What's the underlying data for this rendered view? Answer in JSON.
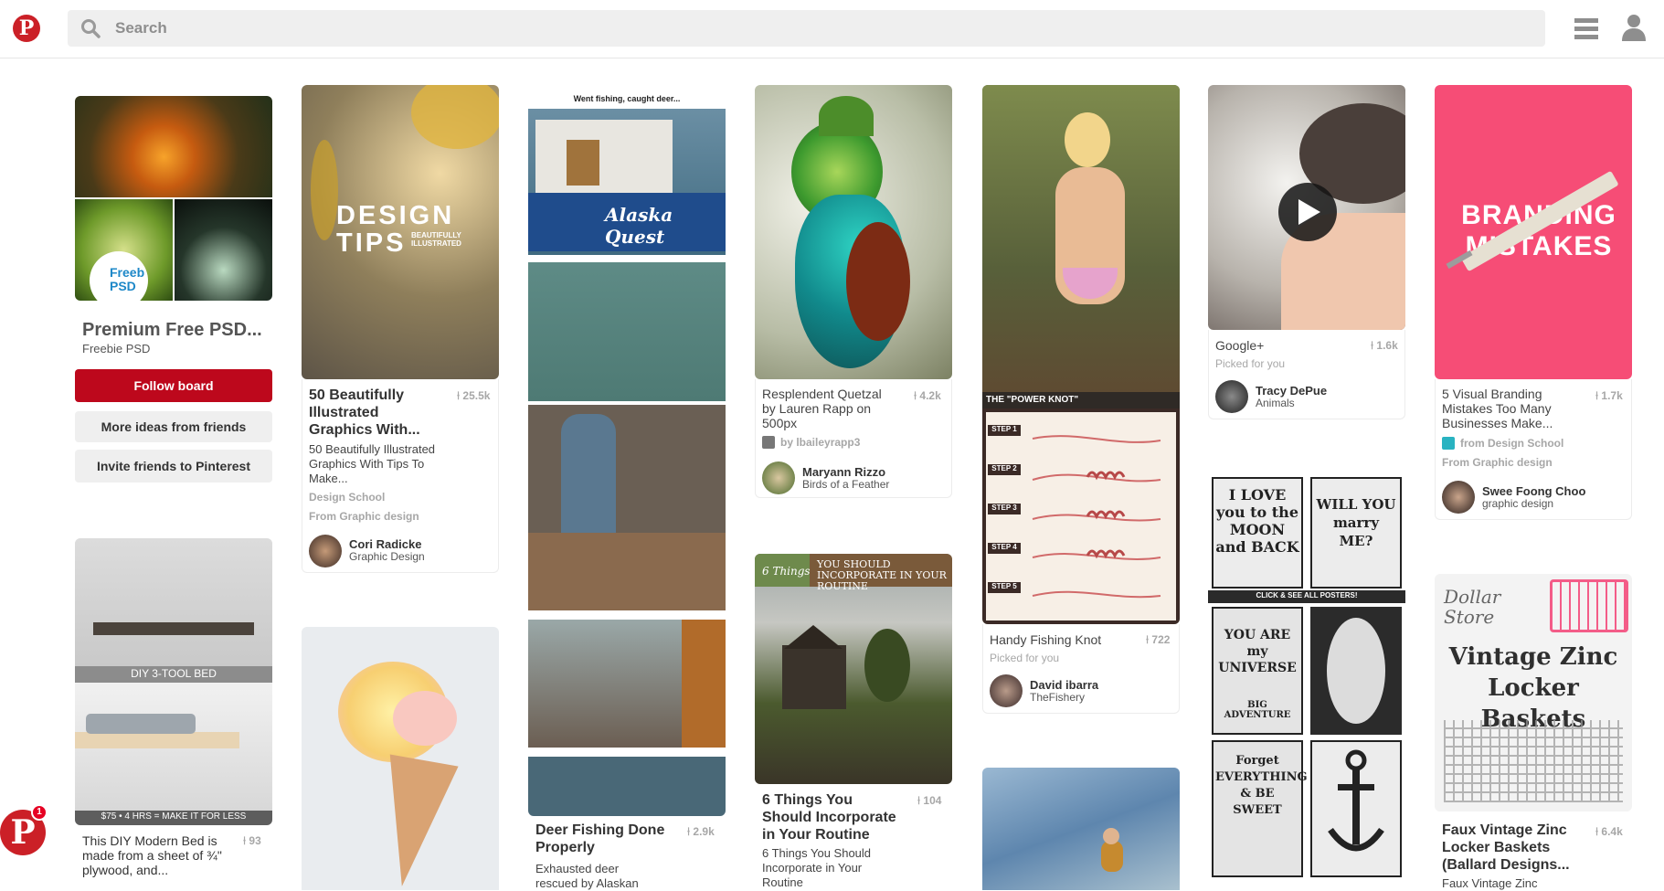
{
  "search": {
    "placeholder": "Search"
  },
  "board": {
    "title": "Premium Free PSD...",
    "owner": "Freebie PSD",
    "badge_text": "Freeb PSD",
    "follow_label": "Follow board",
    "more_ideas_label": "More ideas from friends",
    "invite_label": "Invite friends to Pinterest"
  },
  "pins": {
    "design_tips": {
      "overlay_title": "DESIGN TIPS",
      "overlay_sub": "BEAUTIFULLY ILLUSTRATED",
      "title": "50 Beautifully Illustrated Graphics With...",
      "saves": "25.5k",
      "description": "50 Beautifully Illustrated Graphics With Tips To Make...",
      "source": "Design School",
      "from": "From Graphic design",
      "user": "Cori Radicke",
      "board": "Graphic Design"
    },
    "deer": {
      "caption": "Went fishing, caught deer...",
      "boat_text": "Alaska Quest",
      "title": "Deer Fishing Done Properly",
      "saves": "2.9k",
      "description": "Exhausted deer rescued by Alaskan"
    },
    "quetzal": {
      "title": "Resplendent Quetzal by Lauren Rapp on 500px",
      "saves": "4.2k",
      "via": "by lbaileyrapp3",
      "user": "Maryann Rizzo",
      "board": "Birds of a Feather"
    },
    "routine": {
      "tag": "6 Things",
      "banner": "YOU SHOULD INCORPORATE IN YOUR ROUTINE",
      "title": "6 Things You Should Incorporate in Your Routine",
      "saves": "104",
      "description": "6 Things You Should Incorporate in Your Routine"
    },
    "knot": {
      "banner": "THE \"POWER KNOT\"",
      "steps": [
        "STEP 1",
        "STEP 2",
        "STEP 3",
        "STEP 4",
        "STEP 5"
      ],
      "title": "Handy Fishing Knot",
      "saves": "722",
      "picked": "Picked for you",
      "user": "David ibarra",
      "board": "TheFishery"
    },
    "cat": {
      "title": "Google+",
      "saves": "1.6k",
      "picked": "Picked for you",
      "user": "Tracy DePue",
      "board": "Animals"
    },
    "posters": {
      "strip": "CLICK & SEE ALL POSTERS!",
      "p1": "I LOVE you to the MOON and BACK",
      "p2": "WILL YOU marry ME?",
      "p3": "YOU ARE my UNIVERSE",
      "p4": "Forget EVERYTHING & BE SWEET",
      "p5": "BIG ADVENTURE"
    },
    "branding": {
      "overlay": "BRANDING MISTAKES",
      "title": "5 Visual Branding Mistakes Too Many Businesses Make...",
      "saves": "1.7k",
      "source": "from Design School",
      "from": "From Graphic design",
      "user": "Swee Foong Choo",
      "board": "graphic design"
    },
    "baskets": {
      "store": "Dollar Store",
      "overlay": "Vintage Zinc Locker Baskets",
      "title": "Faux Vintage Zinc Locker Baskets (Ballard Designs...",
      "saves": "6.4k",
      "description": "Faux Vintage Zinc"
    },
    "bed": {
      "label": "DIY 3-TOOL BED",
      "strip": "$75 • 4 HRS = MAKE IT FOR LESS",
      "title": "This DIY Modern Bed is made from a sheet of ¾\" plywood, and...",
      "saves": "93"
    }
  },
  "floating_badge": {
    "count": "1"
  }
}
